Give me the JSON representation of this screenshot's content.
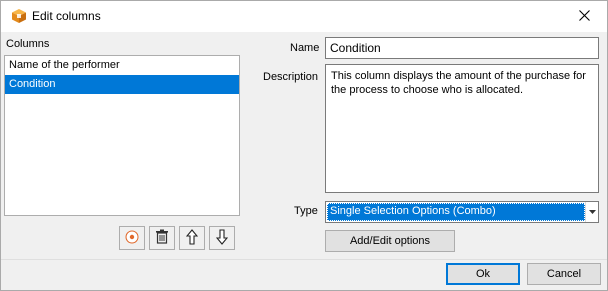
{
  "window": {
    "title": "Edit columns",
    "icon": "app-cube-icon",
    "close_icon": "close-icon"
  },
  "columns": {
    "label": "Columns",
    "items": [
      {
        "label": "Name of the performer",
        "selected": false
      },
      {
        "label": "Condition",
        "selected": true
      }
    ],
    "toolbar": [
      "add-icon",
      "delete-icon",
      "move-up-icon",
      "move-down-icon"
    ]
  },
  "form": {
    "name_label": "Name",
    "name_value": "Condition",
    "description_label": "Description",
    "description_value": "This column displays the amount of the purchase for the process to choose who is allocated.",
    "type_label": "Type",
    "type_value": "Single Selection Options (Combo)",
    "add_edit_label": "Add/Edit options"
  },
  "footer": {
    "ok_label": "Ok",
    "cancel_label": "Cancel"
  },
  "colors": {
    "accent": "#0078d7",
    "icon_orange": "#f0a030"
  }
}
